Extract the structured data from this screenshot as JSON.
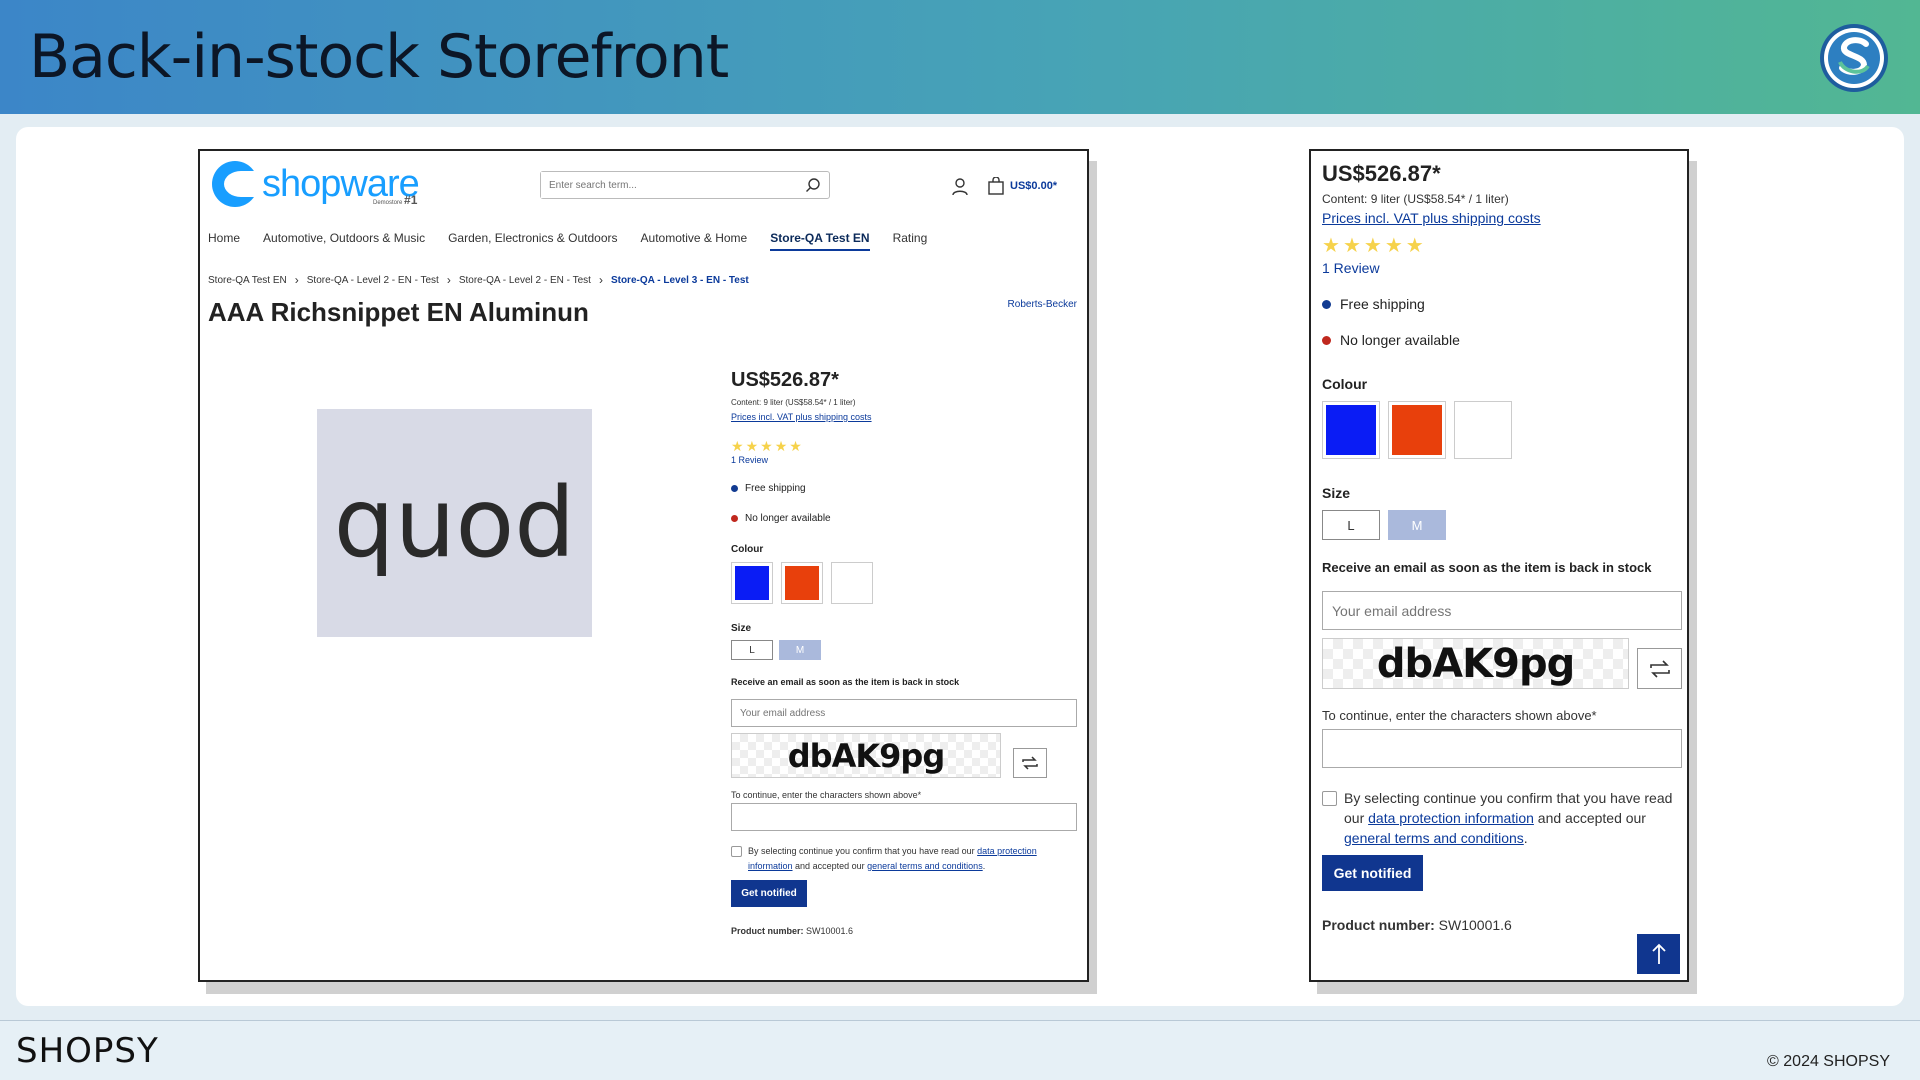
{
  "slide": {
    "title": "Back-in-stock Storefront",
    "footer_brand": "SHOPSY",
    "copyright": "© 2024 SHOPSY"
  },
  "store": {
    "logo_text": "shopware",
    "logo_sub": "Demostore",
    "logo_badge": "#1",
    "search_placeholder": "Enter search term...",
    "cart_total": "US$0.00*",
    "nav": [
      "Home",
      "Automotive, Outdoors & Music",
      "Garden, Electronics & Outdoors",
      "Automotive & Home",
      "Store-QA Test EN",
      "Rating"
    ],
    "breadcrumb": [
      "Store-QA Test EN",
      "Store-QA - Level 2 - EN - Test",
      "Store-QA - Level 2 - EN - Test",
      "Store-QA - Level 3 - EN - Test"
    ],
    "breadcrumb_separator": "›"
  },
  "product": {
    "title": "AAA Richsnippet EN Aluminun",
    "manufacturer": "Roberts-Becker",
    "image_text": "quod",
    "price": "US$526.87*",
    "content": "Content: 9 liter (US$58.54* / 1 liter)",
    "vat_link": "Prices incl. VAT plus shipping costs",
    "rating": 5,
    "review_text": "1 Review",
    "shipping": "Free shipping",
    "availability": "No longer available",
    "colour_label": "Colour",
    "colours": [
      "#0a1cf5",
      "#e8400c",
      "#ffffff"
    ],
    "size_label": "Size",
    "sizes": [
      "L",
      "M"
    ],
    "selected_size": "M",
    "notify_heading": "Receive an email as soon as the item is back in stock",
    "email_placeholder": "Your email address",
    "captcha_text": "dbAK9pg",
    "captcha_label": "To continue, enter the characters shown above*",
    "terms_prefix": "By selecting continue you confirm that you have read our",
    "terms_link1": "data protection information",
    "terms_middle": "and accepted our",
    "terms_link2": "general terms and conditions",
    "terms_suffix": ".",
    "notify_button": "Get notified",
    "product_number_label": "Product number:",
    "product_number": "SW10001.6"
  },
  "colors": {
    "header_gradient_start": "#3c86c8",
    "header_gradient_end": "#52b793",
    "primary": "#10368f",
    "shopware_blue": "#189eff"
  },
  "icons": {
    "search": "search-icon",
    "user": "user-icon",
    "cart": "cart-icon",
    "refresh": "refresh-icon",
    "back_to_top": "arrow-up-icon"
  }
}
